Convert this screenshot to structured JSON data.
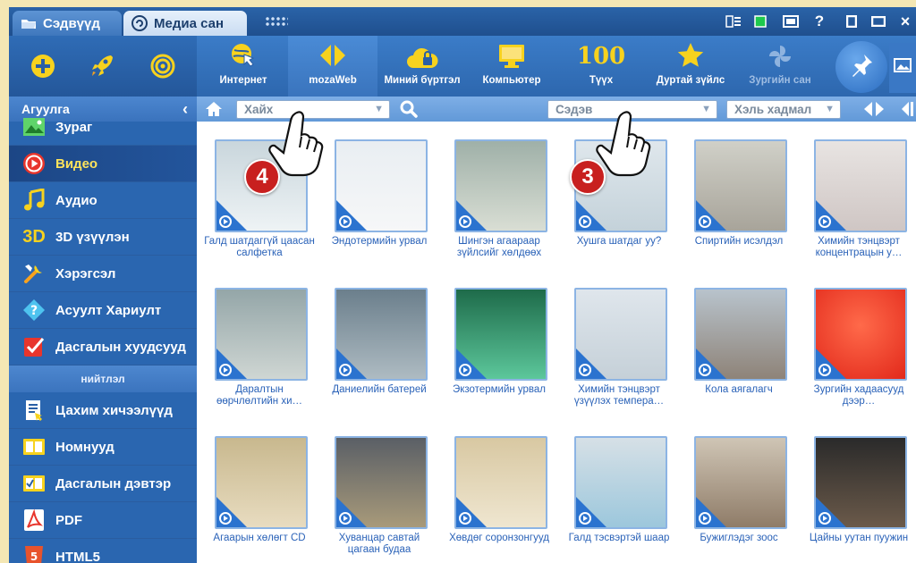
{
  "tabs": [
    {
      "label": "Сэдвүүд",
      "icon": "folder-icon"
    },
    {
      "label": "Медиа сан",
      "icon": "media-icon"
    }
  ],
  "toolbar": {
    "tools": [
      {
        "label": "Интернет",
        "icon": "globe-cursor-icon"
      },
      {
        "label": "mozaWeb",
        "icon": "mozaweb-diamond-icon"
      },
      {
        "label": "Миний бүртгэл",
        "icon": "cloud-lock-icon"
      },
      {
        "label": "Компьютер",
        "icon": "monitor-icon"
      },
      {
        "label": "Түүх",
        "icon": "history-100-icon",
        "glyph": "100"
      },
      {
        "label": "Дуртай зүйлс",
        "icon": "star-icon"
      },
      {
        "label": "Зургийн сан",
        "icon": "pinwheel-icon"
      }
    ]
  },
  "sidebar": {
    "header": "Агуулга",
    "items": [
      {
        "label": "Зураг",
        "icon": "image-icon"
      },
      {
        "label": "Видео",
        "icon": "video-play-icon",
        "selected": true
      },
      {
        "label": "Аудио",
        "icon": "music-note-icon"
      },
      {
        "label": "3D үзүүлэн",
        "icon": "3d-icon",
        "glyph": "3D"
      },
      {
        "label": "Хэрэгсэл",
        "icon": "tools-icon"
      },
      {
        "label": "Асуулт Хариулт",
        "icon": "question-icon"
      },
      {
        "label": "Дасгалын хуудсууд",
        "icon": "checkbox-icon"
      }
    ],
    "section_label": "нийтлэл",
    "items2": [
      {
        "label": "Цахим хичээлүүд",
        "icon": "lesson-icon"
      },
      {
        "label": "Номнууд",
        "icon": "book-icon"
      },
      {
        "label": "Дасгалын дэвтэр",
        "icon": "workbook-icon"
      },
      {
        "label": "PDF",
        "icon": "pdf-icon"
      },
      {
        "label": "HTML5",
        "icon": "html5-icon"
      }
    ]
  },
  "filters": {
    "search_placeholder": "Хайх",
    "topic_placeholder": "Сэдэв",
    "language_placeholder": "Хэль хадмал"
  },
  "badges": [
    "4",
    "3"
  ],
  "videos": [
    {
      "title": "Галд шатдаггүй цаасан салфетка"
    },
    {
      "title": "Эндотермийн урвал"
    },
    {
      "title": "Шингэн агаараар зүйлсийг хөлдөөх"
    },
    {
      "title": "Хушга шатдаг уу?"
    },
    {
      "title": "Спиртийн исэлдэл"
    },
    {
      "title": "Химийн тэнцвэрт концентрацын у…"
    },
    {
      "title": "Даралтын өөрчлөлтийн хи…"
    },
    {
      "title": "Даниелийн батерей"
    },
    {
      "title": "Экзотермийн урвал"
    },
    {
      "title": "Химийн тэнцвэрт үзүүлэх темпера…"
    },
    {
      "title": "Кола аягалагч"
    },
    {
      "title": "Зургийн хадаасууд дээр…"
    },
    {
      "title": "Агаарын хөлөгт CD"
    },
    {
      "title": "Хуванцар савтай цагаан будаа"
    },
    {
      "title": "Хөвдөг соронзонгууд"
    },
    {
      "title": "Галд тэсвэртэй шаар"
    },
    {
      "title": "Бужиглэдэг зоос"
    },
    {
      "title": "Цайны уутан пуужин"
    }
  ],
  "colors": {
    "sidebar_bg": "#2a66b0",
    "selected_text": "#ffe45b",
    "link_text": "#2a62b8",
    "badge": "#c8201f",
    "play_corner": "#2b73cf"
  }
}
